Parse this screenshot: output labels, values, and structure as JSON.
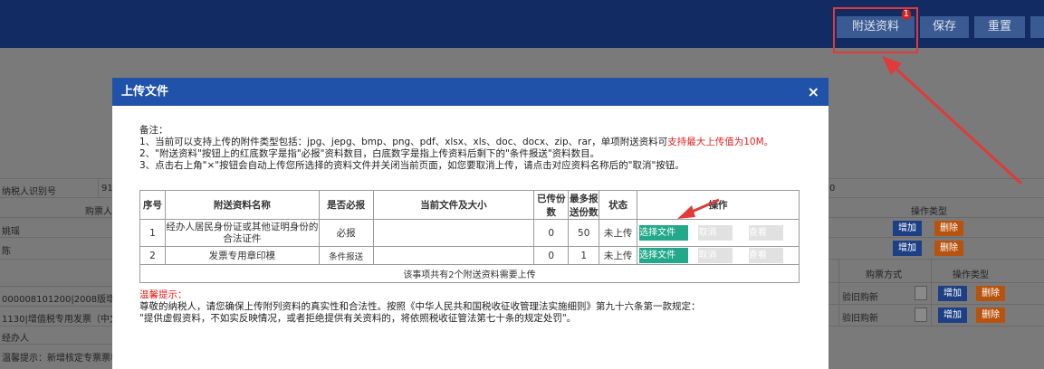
{
  "toolbar": {
    "attach_label": "附送资料",
    "attach_badge": "1",
    "save_label": "保存",
    "reset_label": "重置"
  },
  "background": {
    "taxpayer_id_label": "纳税人识别号",
    "taxpayer_id_value_prefix": "91",
    "field_fragment": "0",
    "buyer_label": "购票人",
    "op_type_label": "操作类型",
    "row1_name": "姚瑶",
    "row2_name": "陈",
    "add_label": "增加",
    "delete_label": "删除",
    "buy_method_label": "购票方式",
    "invoice_row1": "000008101200|2008版增值",
    "invoice_row2": "1130|增值税专用发票（中文",
    "agent_label": "经办人",
    "buy_method_value": "验旧购新",
    "tip_fragment": "温馨提示：新增核定专票票种和"
  },
  "modal": {
    "title": "上传文件",
    "close": "×",
    "notes": {
      "heading": "备注：",
      "line1_a": "1、当前可以支持上传的附件类型包括：jpg、jepg、bmp、png、pdf、xlsx、xls、doc、docx、zip、rar，单项附送资料可",
      "line1_b": "支持最大上传值为10M。",
      "line2": "2、\"附送资料\"按钮上的红底数字是指\"必报\"资料数目，白底数字是指上传资料后剩下的\"条件报送\"资料数目。",
      "line3": "3、点击右上角\"×\"按钮会自动上传您所选择的资料文件并关闭当前页面，如您要取消上传，请点击对应资料名称后的\"取消\"按钮。"
    },
    "table": {
      "headers": {
        "seq": "序号",
        "name": "附送资料名称",
        "required": "是否必报",
        "file": "当前文件及大小",
        "uploaded": "已传份数",
        "max": "最多报送份数",
        "status": "状态",
        "ops": "操作"
      },
      "rows": [
        {
          "seq": "1",
          "name": "经办人居民身份证或其他证明身份的合法证件",
          "required": "必报",
          "file": "",
          "uploaded": "0",
          "max": "50",
          "status": "未上传",
          "choose": "选择文件",
          "cancel": "取消",
          "view": "查看"
        },
        {
          "seq": "2",
          "name": "发票专用章印模",
          "required": "条件报送",
          "file": "",
          "uploaded": "0",
          "max": "1",
          "status": "未上传",
          "choose": "选择文件",
          "cancel": "取消",
          "view": "查看"
        }
      ],
      "footer": "该事项共有2个附送资料需要上传"
    },
    "warning": {
      "title": "温馨提示：",
      "line1": "尊敬的纳税人，请您确保上传附列资料的真实性和合法性。按照《中华人民共和国税收征收管理法实施细则》第九十六条第一款规定：",
      "line2": "\"提供虚假资料，不如实反映情况，或者拒绝提供有关资料的，将依照税收征管法第七十条的规定处罚\"。"
    }
  },
  "colors": {
    "header_bg": "#132b63",
    "modal_header": "#2052a9",
    "choose_button": "#22a88a",
    "highlight_red": "#e02020",
    "annotation_red": "#e03a3a"
  }
}
